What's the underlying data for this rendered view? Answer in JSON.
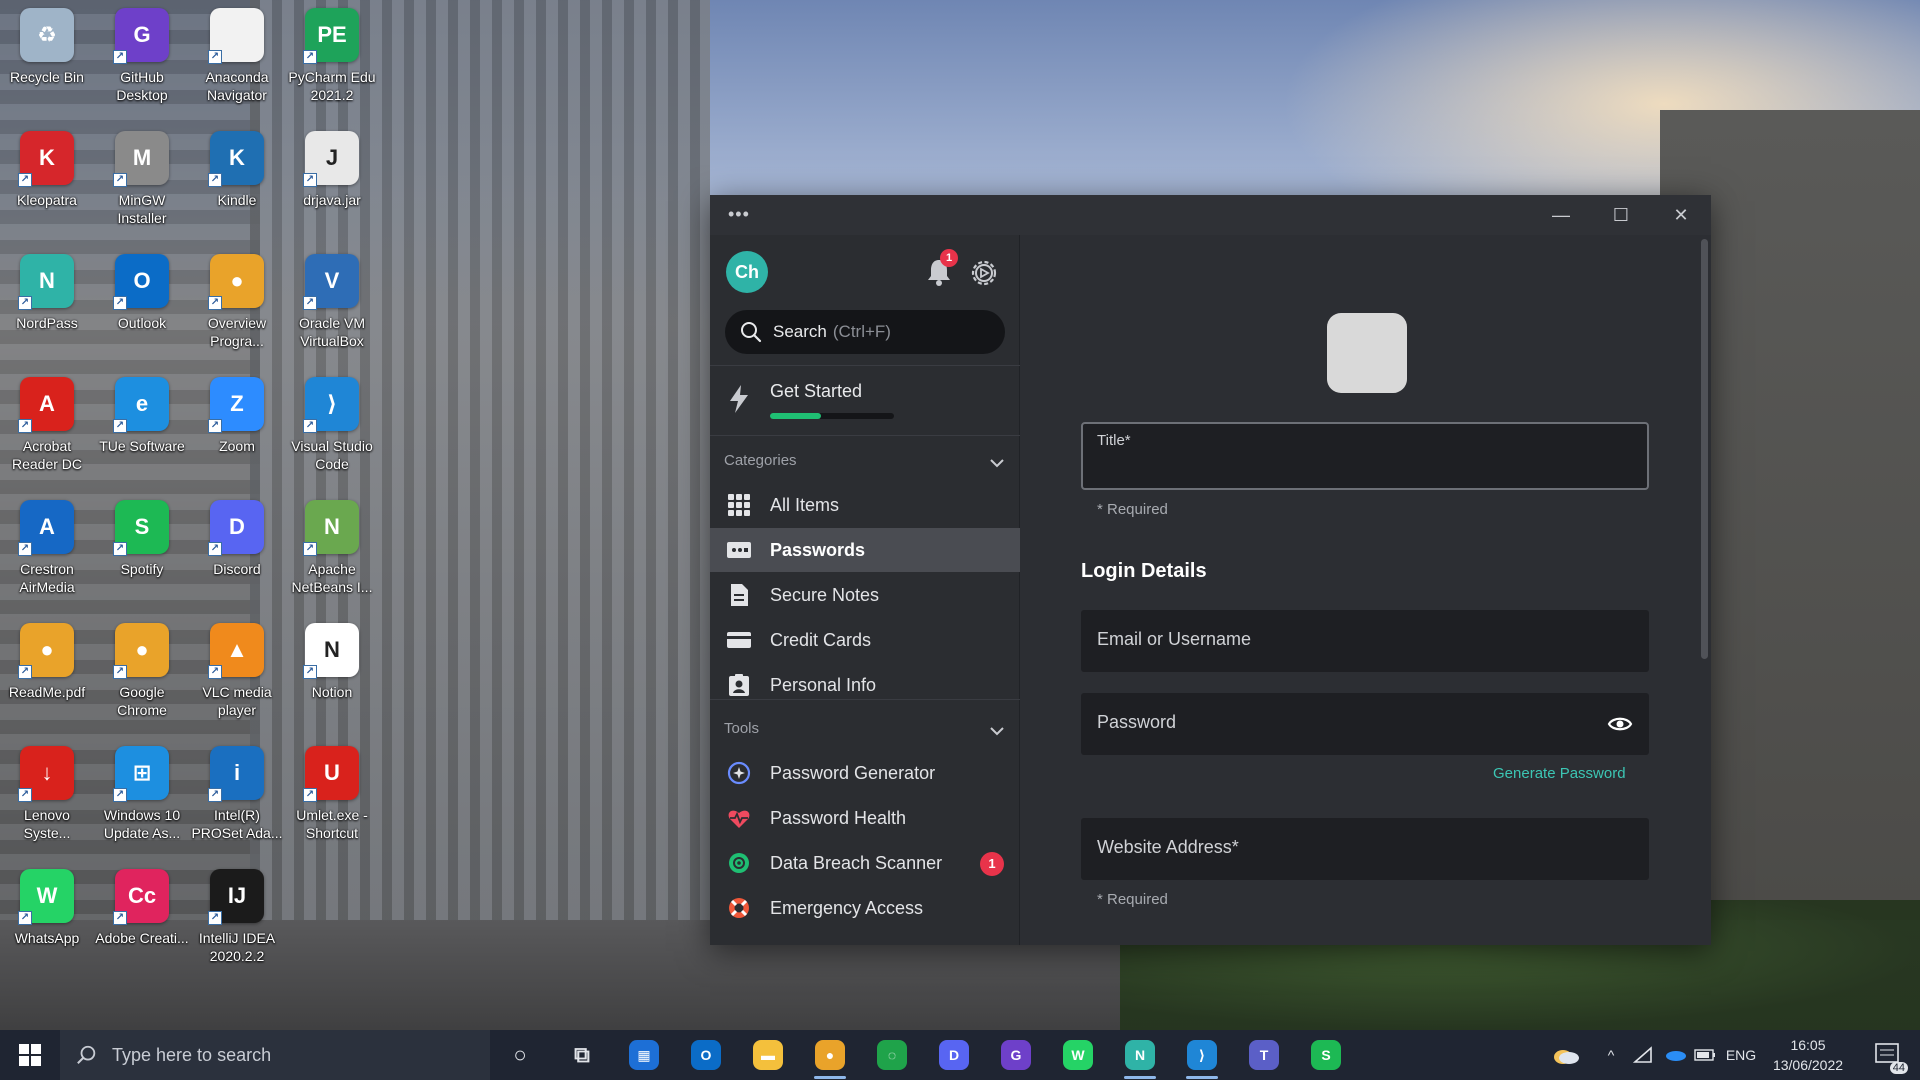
{
  "desktop": {
    "icons": [
      {
        "label": "Recycle Bin",
        "color": "#9fb4c8",
        "glyph": "♻"
      },
      {
        "label": "GitHub Desktop",
        "color": "#6e40c9",
        "glyph": "G"
      },
      {
        "label": "Anaconda Navigator",
        "color": "#f2f2f2",
        "glyph": ""
      },
      {
        "label": "PyCharm Edu 2021.2",
        "color": "#1ea35a",
        "glyph": "PE"
      },
      {
        "label": "Kleopatra",
        "color": "#d6262b",
        "glyph": "K"
      },
      {
        "label": "MinGW Installer",
        "color": "#8a8a8a",
        "glyph": "M"
      },
      {
        "label": "Kindle",
        "color": "#1f6fb2",
        "glyph": "K"
      },
      {
        "label": "drjava.jar",
        "color": "#e8e8e8",
        "glyph": "J"
      },
      {
        "label": "NordPass",
        "color": "#2fb3a7",
        "glyph": "N"
      },
      {
        "label": "Outlook",
        "color": "#0b6cc7",
        "glyph": "O"
      },
      {
        "label": "Overview Progra...",
        "color": "#e9a32a",
        "glyph": "●"
      },
      {
        "label": "Oracle VM VirtualBox",
        "color": "#2e6db6",
        "glyph": "V"
      },
      {
        "label": "Acrobat Reader DC",
        "color": "#d9221c",
        "glyph": "A"
      },
      {
        "label": "TUe Software",
        "color": "#1d8fe0",
        "glyph": "e"
      },
      {
        "label": "Zoom",
        "color": "#2d8cff",
        "glyph": "Z"
      },
      {
        "label": "Visual Studio Code",
        "color": "#1f86d6",
        "glyph": "⟩"
      },
      {
        "label": "Crestron AirMedia",
        "color": "#1668c5",
        "glyph": "A"
      },
      {
        "label": "Spotify",
        "color": "#1db954",
        "glyph": "S"
      },
      {
        "label": "Discord",
        "color": "#5865f2",
        "glyph": "D"
      },
      {
        "label": "Apache NetBeans I...",
        "color": "#6aa84f",
        "glyph": "N"
      },
      {
        "label": "ReadMe.pdf",
        "color": "#e9a32a",
        "glyph": "●"
      },
      {
        "label": "Google Chrome",
        "color": "#e9a32a",
        "glyph": "●"
      },
      {
        "label": "VLC media player",
        "color": "#f08a1c",
        "glyph": "▲"
      },
      {
        "label": "Notion",
        "color": "#ffffff",
        "glyph": "N"
      },
      {
        "label": "Lenovo Syste...",
        "color": "#d9221c",
        "glyph": "↓"
      },
      {
        "label": "Windows 10 Update As...",
        "color": "#1d8fe0",
        "glyph": "⊞"
      },
      {
        "label": "Intel(R) PROSet Ada...",
        "color": "#1a6fc0",
        "glyph": "i"
      },
      {
        "label": "Umlet.exe - Shortcut",
        "color": "#d9221c",
        "glyph": "U"
      },
      {
        "label": "WhatsApp",
        "color": "#25d366",
        "glyph": "W"
      },
      {
        "label": "Adobe Creati...",
        "color": "#e0245e",
        "glyph": "Cc"
      },
      {
        "label": "IntelliJ IDEA 2020.2.2",
        "color": "#1b1b1b",
        "glyph": "IJ"
      }
    ]
  },
  "window": {
    "menu_dots": "•••",
    "minimize": "—",
    "maximize": "☐",
    "close": "✕"
  },
  "sidebar": {
    "avatar_initials": "Ch",
    "notification_count": "1",
    "search_label": "Search",
    "search_hint": "(Ctrl+F)",
    "get_started": {
      "label": "Get Started",
      "progress": 0.41
    },
    "categories_heading": "Categories",
    "categories": [
      {
        "label": "All Items",
        "icon": "grid-icon",
        "active": false
      },
      {
        "label": "Passwords",
        "icon": "password-card-icon",
        "active": true
      },
      {
        "label": "Secure Notes",
        "icon": "note-icon",
        "active": false
      },
      {
        "label": "Credit Cards",
        "icon": "credit-card-icon",
        "active": false
      },
      {
        "label": "Personal Info",
        "icon": "id-badge-icon",
        "active": false
      }
    ],
    "tools_heading": "Tools",
    "tools": [
      {
        "label": "Password Generator",
        "icon": "generator-icon",
        "badge": ""
      },
      {
        "label": "Password Health",
        "icon": "heartbeat-icon",
        "badge": ""
      },
      {
        "label": "Data Breach Scanner",
        "icon": "scanner-icon",
        "badge": "1"
      },
      {
        "label": "Emergency Access",
        "icon": "lifebuoy-icon",
        "badge": ""
      }
    ]
  },
  "main": {
    "title_label": "Title*",
    "title_required": "* Required",
    "login_details_heading": "Login Details",
    "email_placeholder": "Email or Username",
    "password_placeholder": "Password",
    "generate_password": "Generate Password",
    "website_placeholder": "Website Address*",
    "website_required": "* Required"
  },
  "taskbar": {
    "search_placeholder": "Type here to search",
    "apps": [
      {
        "name": "cortana",
        "color": "transparent",
        "glyph": "○",
        "open": false
      },
      {
        "name": "task-view",
        "color": "transparent",
        "glyph": "⧉",
        "open": false
      },
      {
        "name": "calendar",
        "color": "#1d6fd6",
        "glyph": "▦",
        "open": false
      },
      {
        "name": "outlook",
        "color": "#0b6cc7",
        "glyph": "O",
        "open": false
      },
      {
        "name": "file-explorer",
        "color": "#f4c03c",
        "glyph": "▬",
        "open": false
      },
      {
        "name": "chrome",
        "color": "#e9a32a",
        "glyph": "●",
        "open": true
      },
      {
        "name": "circle-app",
        "color": "#1fa34a",
        "glyph": "◌",
        "open": false
      },
      {
        "name": "discord",
        "color": "#5865f2",
        "glyph": "D",
        "open": false
      },
      {
        "name": "github-desktop",
        "color": "#6e40c9",
        "glyph": "G",
        "open": false
      },
      {
        "name": "whatsapp",
        "color": "#25d366",
        "glyph": "W",
        "open": false
      },
      {
        "name": "nordpass",
        "color": "#2fb3a7",
        "glyph": "N",
        "open": true
      },
      {
        "name": "vscode",
        "color": "#1f86d6",
        "glyph": "⟩",
        "open": true
      },
      {
        "name": "teams",
        "color": "#5b5fc7",
        "glyph": "T",
        "open": false
      },
      {
        "name": "spotify",
        "color": "#1db954",
        "glyph": "S",
        "open": false
      }
    ],
    "tray": {
      "weather_icon": "cloud-icon",
      "chevron": "^",
      "language": "ENG",
      "time": "16:05",
      "date": "13/06/2022",
      "notification_count": "44"
    }
  }
}
